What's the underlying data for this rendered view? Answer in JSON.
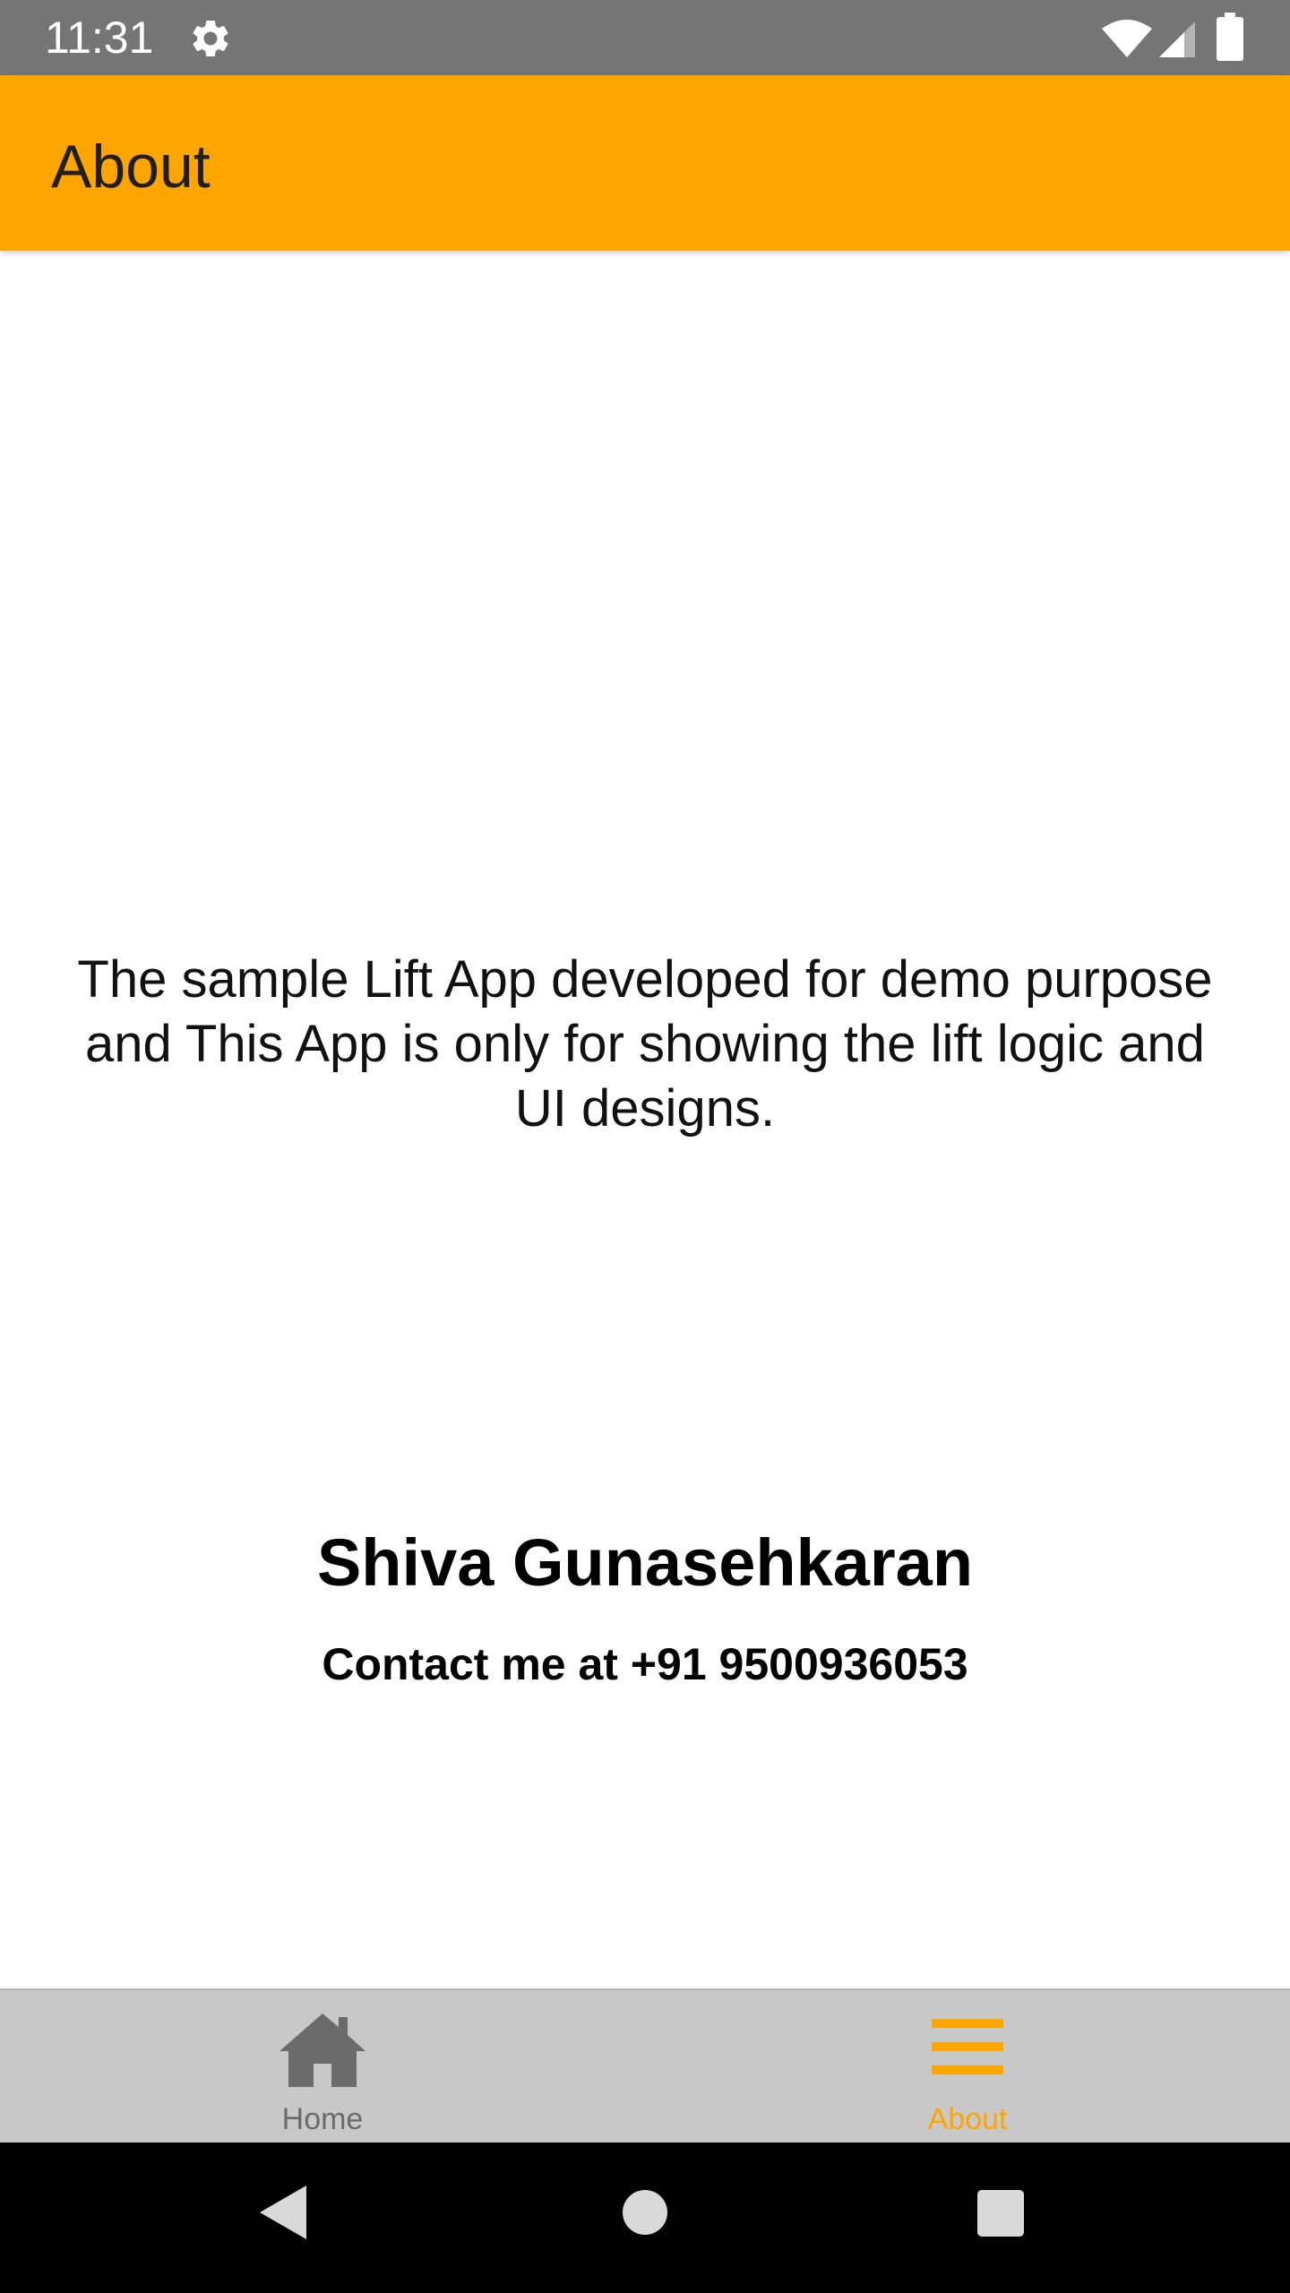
{
  "status_bar": {
    "time": "11:31",
    "icons": [
      "gear-icon",
      "wifi-icon",
      "signal-icon",
      "battery-icon"
    ]
  },
  "app_bar": {
    "title": "About",
    "background_color": "#ffa500"
  },
  "main": {
    "description": "The sample Lift App developed for demo purpose and This App is only for showing the lift logic and UI designs.",
    "author_name": "Shiva Gunasehkaran",
    "contact": "Contact me at +91 9500936053"
  },
  "bottom_nav": {
    "items": [
      {
        "label": "Home",
        "icon": "home-icon",
        "active": false,
        "color": "#6b6b6b"
      },
      {
        "label": "About",
        "icon": "menu-icon",
        "active": true,
        "color": "#ffa500"
      }
    ],
    "background_color": "#c8c8c8"
  },
  "system_nav": {
    "icons": [
      "back-icon",
      "home-circle-icon",
      "recents-icon"
    ]
  }
}
